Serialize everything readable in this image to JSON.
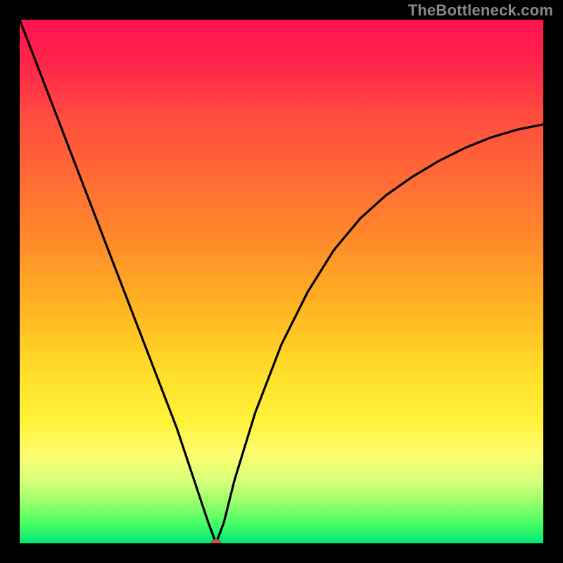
{
  "watermark": "TheBottleneck.com",
  "colors": {
    "frame": "#000000",
    "curve": "#000000",
    "marker": "#d14c4c",
    "gradient_top": "#ff1a4d",
    "gradient_bottom": "#00e676"
  },
  "chart_data": {
    "type": "line",
    "title": "",
    "xlabel": "",
    "ylabel": "",
    "xlim": [
      0,
      100
    ],
    "ylim": [
      0,
      100
    ],
    "grid": false,
    "legend": false,
    "series": [
      {
        "name": "bottleneck-curve",
        "x": [
          0,
          5,
          10,
          15,
          20,
          25,
          30,
          34,
          36,
          37.5,
          39,
          41,
          45,
          50,
          55,
          60,
          65,
          70,
          75,
          80,
          85,
          90,
          95,
          100
        ],
        "y": [
          100,
          87,
          74,
          61,
          48,
          35,
          22,
          10,
          4,
          0,
          4,
          12,
          25,
          38,
          48,
          56,
          62,
          66.5,
          70,
          73,
          75.5,
          77.5,
          79,
          80
        ]
      }
    ],
    "marker": {
      "x": 37.5,
      "y": 0
    },
    "background": "rainbow-vertical-gradient"
  }
}
